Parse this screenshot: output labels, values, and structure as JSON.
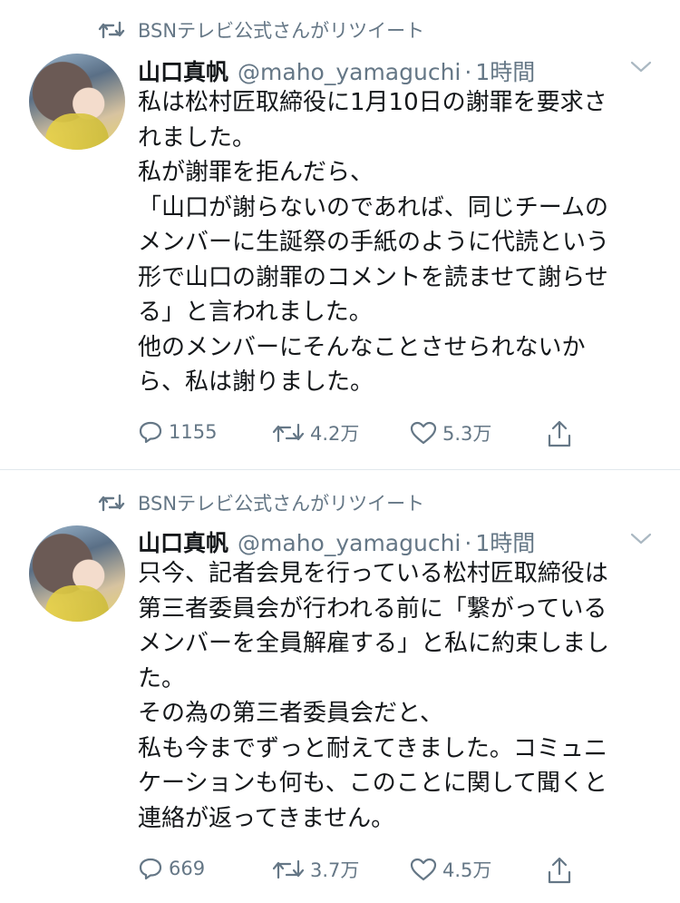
{
  "tweets": [
    {
      "retweeted_by": "BSNテレビ公式さんがリツイート",
      "name": "山口真帆",
      "handle": "@maho_yamaguchi",
      "separator": "·",
      "time": "1時間",
      "body": [
        "私は松村匠取締役に1月10日の謝罪を要求さ",
        "れました。",
        "私が謝罪を拒んだら、",
        "「山口が謝らないのであれば、同じチームの",
        "メンバーに生誕祭の手紙のように代読という",
        "形で山口の謝罪のコメントを読ませて謝らせ",
        "る」と言われました。",
        "他のメンバーにそんなことさせられないか",
        "ら、私は謝りました。"
      ],
      "replies": "1155",
      "retweets": "4.2万",
      "likes": "5.3万"
    },
    {
      "retweeted_by": "BSNテレビ公式さんがリツイート",
      "name": "山口真帆",
      "handle": "@maho_yamaguchi",
      "separator": "·",
      "time": "1時間",
      "body": [
        "只今、記者会見を行っている松村匠取締役は",
        "第三者委員会が行われる前に「繋がっている",
        "メンバーを全員解雇する」と私に約束しまし",
        "た。",
        "その為の第三者委員会だと、",
        "私も今までずっと耐えてきました。コミュニ",
        "ケーションも何も、このことに関して聞くと",
        "連絡が返ってきません。"
      ],
      "replies": "669",
      "retweets": "3.7万",
      "likes": "4.5万"
    }
  ],
  "icons": {
    "retweet": "retweet-icon",
    "reply": "reply-icon",
    "like": "heart-icon",
    "share": "share-icon",
    "caret": "chevron-down-icon"
  },
  "colors": {
    "text": "#14171a",
    "secondary": "#657786",
    "divider": "#e1e8ed"
  }
}
